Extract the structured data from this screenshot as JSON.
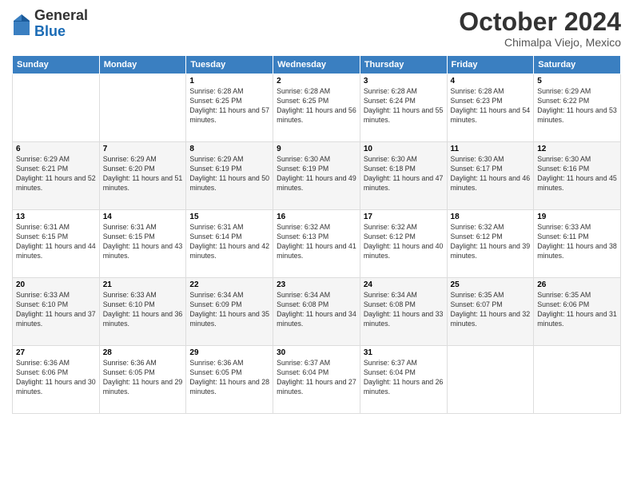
{
  "header": {
    "logo_general": "General",
    "logo_blue": "Blue",
    "month_title": "October 2024",
    "location": "Chimalpa Viejo, Mexico"
  },
  "weekdays": [
    "Sunday",
    "Monday",
    "Tuesday",
    "Wednesday",
    "Thursday",
    "Friday",
    "Saturday"
  ],
  "weeks": [
    [
      {
        "day": "",
        "sunrise": "",
        "sunset": "",
        "daylight": ""
      },
      {
        "day": "",
        "sunrise": "",
        "sunset": "",
        "daylight": ""
      },
      {
        "day": "1",
        "sunrise": "Sunrise: 6:28 AM",
        "sunset": "Sunset: 6:25 PM",
        "daylight": "Daylight: 11 hours and 57 minutes."
      },
      {
        "day": "2",
        "sunrise": "Sunrise: 6:28 AM",
        "sunset": "Sunset: 6:25 PM",
        "daylight": "Daylight: 11 hours and 56 minutes."
      },
      {
        "day": "3",
        "sunrise": "Sunrise: 6:28 AM",
        "sunset": "Sunset: 6:24 PM",
        "daylight": "Daylight: 11 hours and 55 minutes."
      },
      {
        "day": "4",
        "sunrise": "Sunrise: 6:28 AM",
        "sunset": "Sunset: 6:23 PM",
        "daylight": "Daylight: 11 hours and 54 minutes."
      },
      {
        "day": "5",
        "sunrise": "Sunrise: 6:29 AM",
        "sunset": "Sunset: 6:22 PM",
        "daylight": "Daylight: 11 hours and 53 minutes."
      }
    ],
    [
      {
        "day": "6",
        "sunrise": "Sunrise: 6:29 AM",
        "sunset": "Sunset: 6:21 PM",
        "daylight": "Daylight: 11 hours and 52 minutes."
      },
      {
        "day": "7",
        "sunrise": "Sunrise: 6:29 AM",
        "sunset": "Sunset: 6:20 PM",
        "daylight": "Daylight: 11 hours and 51 minutes."
      },
      {
        "day": "8",
        "sunrise": "Sunrise: 6:29 AM",
        "sunset": "Sunset: 6:19 PM",
        "daylight": "Daylight: 11 hours and 50 minutes."
      },
      {
        "day": "9",
        "sunrise": "Sunrise: 6:30 AM",
        "sunset": "Sunset: 6:19 PM",
        "daylight": "Daylight: 11 hours and 49 minutes."
      },
      {
        "day": "10",
        "sunrise": "Sunrise: 6:30 AM",
        "sunset": "Sunset: 6:18 PM",
        "daylight": "Daylight: 11 hours and 47 minutes."
      },
      {
        "day": "11",
        "sunrise": "Sunrise: 6:30 AM",
        "sunset": "Sunset: 6:17 PM",
        "daylight": "Daylight: 11 hours and 46 minutes."
      },
      {
        "day": "12",
        "sunrise": "Sunrise: 6:30 AM",
        "sunset": "Sunset: 6:16 PM",
        "daylight": "Daylight: 11 hours and 45 minutes."
      }
    ],
    [
      {
        "day": "13",
        "sunrise": "Sunrise: 6:31 AM",
        "sunset": "Sunset: 6:15 PM",
        "daylight": "Daylight: 11 hours and 44 minutes."
      },
      {
        "day": "14",
        "sunrise": "Sunrise: 6:31 AM",
        "sunset": "Sunset: 6:15 PM",
        "daylight": "Daylight: 11 hours and 43 minutes."
      },
      {
        "day": "15",
        "sunrise": "Sunrise: 6:31 AM",
        "sunset": "Sunset: 6:14 PM",
        "daylight": "Daylight: 11 hours and 42 minutes."
      },
      {
        "day": "16",
        "sunrise": "Sunrise: 6:32 AM",
        "sunset": "Sunset: 6:13 PM",
        "daylight": "Daylight: 11 hours and 41 minutes."
      },
      {
        "day": "17",
        "sunrise": "Sunrise: 6:32 AM",
        "sunset": "Sunset: 6:12 PM",
        "daylight": "Daylight: 11 hours and 40 minutes."
      },
      {
        "day": "18",
        "sunrise": "Sunrise: 6:32 AM",
        "sunset": "Sunset: 6:12 PM",
        "daylight": "Daylight: 11 hours and 39 minutes."
      },
      {
        "day": "19",
        "sunrise": "Sunrise: 6:33 AM",
        "sunset": "Sunset: 6:11 PM",
        "daylight": "Daylight: 11 hours and 38 minutes."
      }
    ],
    [
      {
        "day": "20",
        "sunrise": "Sunrise: 6:33 AM",
        "sunset": "Sunset: 6:10 PM",
        "daylight": "Daylight: 11 hours and 37 minutes."
      },
      {
        "day": "21",
        "sunrise": "Sunrise: 6:33 AM",
        "sunset": "Sunset: 6:10 PM",
        "daylight": "Daylight: 11 hours and 36 minutes."
      },
      {
        "day": "22",
        "sunrise": "Sunrise: 6:34 AM",
        "sunset": "Sunset: 6:09 PM",
        "daylight": "Daylight: 11 hours and 35 minutes."
      },
      {
        "day": "23",
        "sunrise": "Sunrise: 6:34 AM",
        "sunset": "Sunset: 6:08 PM",
        "daylight": "Daylight: 11 hours and 34 minutes."
      },
      {
        "day": "24",
        "sunrise": "Sunrise: 6:34 AM",
        "sunset": "Sunset: 6:08 PM",
        "daylight": "Daylight: 11 hours and 33 minutes."
      },
      {
        "day": "25",
        "sunrise": "Sunrise: 6:35 AM",
        "sunset": "Sunset: 6:07 PM",
        "daylight": "Daylight: 11 hours and 32 minutes."
      },
      {
        "day": "26",
        "sunrise": "Sunrise: 6:35 AM",
        "sunset": "Sunset: 6:06 PM",
        "daylight": "Daylight: 11 hours and 31 minutes."
      }
    ],
    [
      {
        "day": "27",
        "sunrise": "Sunrise: 6:36 AM",
        "sunset": "Sunset: 6:06 PM",
        "daylight": "Daylight: 11 hours and 30 minutes."
      },
      {
        "day": "28",
        "sunrise": "Sunrise: 6:36 AM",
        "sunset": "Sunset: 6:05 PM",
        "daylight": "Daylight: 11 hours and 29 minutes."
      },
      {
        "day": "29",
        "sunrise": "Sunrise: 6:36 AM",
        "sunset": "Sunset: 6:05 PM",
        "daylight": "Daylight: 11 hours and 28 minutes."
      },
      {
        "day": "30",
        "sunrise": "Sunrise: 6:37 AM",
        "sunset": "Sunset: 6:04 PM",
        "daylight": "Daylight: 11 hours and 27 minutes."
      },
      {
        "day": "31",
        "sunrise": "Sunrise: 6:37 AM",
        "sunset": "Sunset: 6:04 PM",
        "daylight": "Daylight: 11 hours and 26 minutes."
      },
      {
        "day": "",
        "sunrise": "",
        "sunset": "",
        "daylight": ""
      },
      {
        "day": "",
        "sunrise": "",
        "sunset": "",
        "daylight": ""
      }
    ]
  ]
}
